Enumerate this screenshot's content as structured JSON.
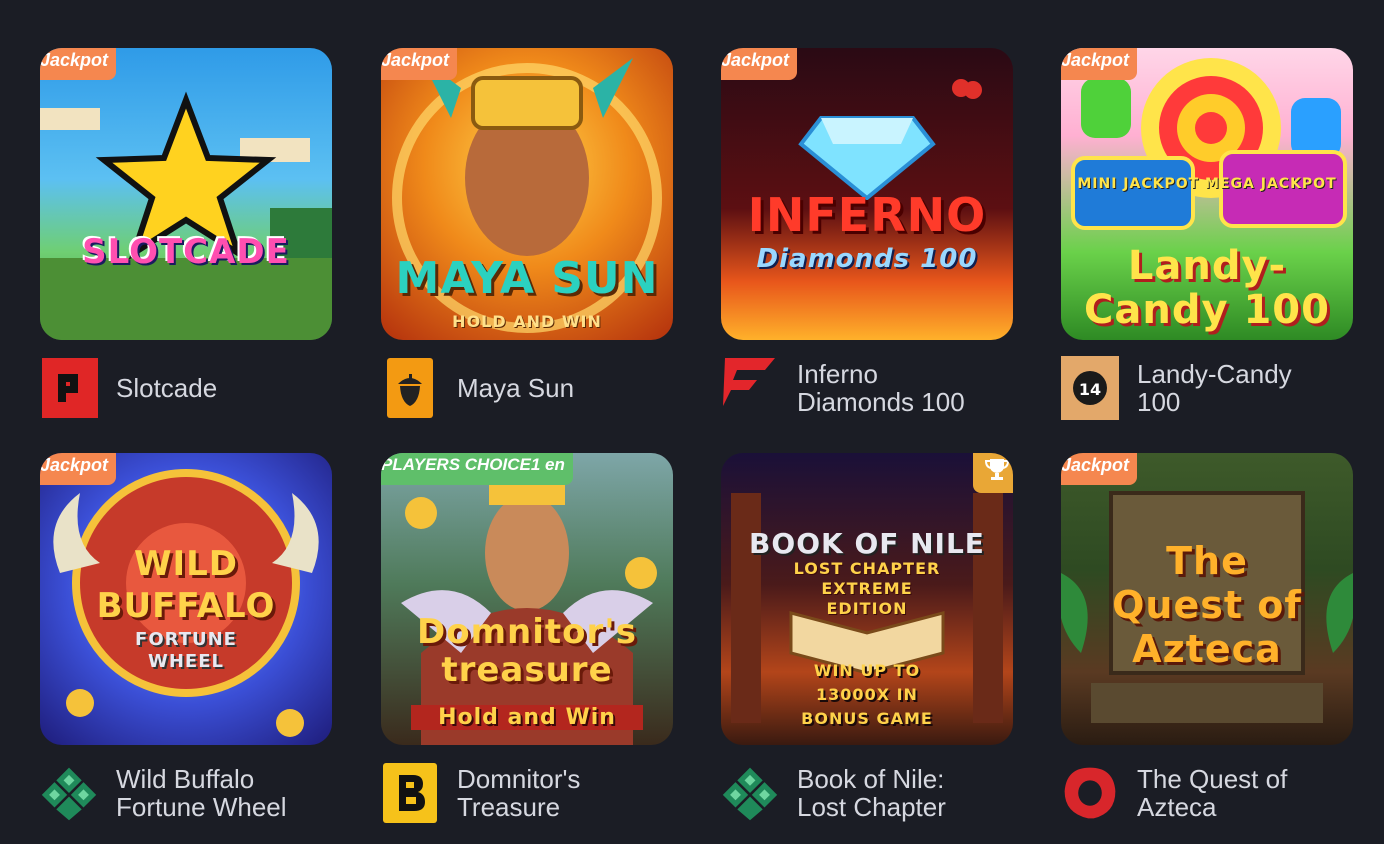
{
  "games": [
    {
      "name": "Slotcade",
      "badge": "Jackpot",
      "art_title": "SLOTCADE",
      "provider_icon": "provider-p-icon"
    },
    {
      "name": "Maya Sun",
      "badge": "Jackpot",
      "art_title": "MAYA SUN",
      "art_subtitle": "HOLD AND WIN",
      "provider_icon": "provider-acorn-icon"
    },
    {
      "name": "Inferno Diamonds 100",
      "badge": "Jackpot",
      "art_title": "INFERNO",
      "art_subtitle": "Diamonds 100",
      "provider_icon": "provider-f-icon"
    },
    {
      "name": "Landy-Candy 100",
      "badge": "Jackpot",
      "art_title": "Landy-Candy 100",
      "art_subtitle": "MINI JACKPOT  MEGA JACKPOT",
      "provider_icon": "provider-14-icon",
      "provider_label": "14"
    },
    {
      "name": "Wild Buffalo Fortune Wheel",
      "badge": "Jackpot",
      "art_title": "WILD BUFFALO",
      "art_subtitle": "FORTUNE WHEEL",
      "provider_icon": "provider-diamond-icon"
    },
    {
      "name": "Domnitor's Treasure",
      "badge": "PLAYERS CHOICE1 en",
      "art_title": "Domnitor's treasure",
      "art_subtitle": "Hold and Win",
      "provider_icon": "provider-b-icon"
    },
    {
      "name": "Book of Nile: Lost Chapter",
      "badge_icon": "trophy-icon",
      "art_title": "BOOK OF NILE",
      "art_subtitle": "LOST CHAPTER EXTREME EDITION",
      "art_extra": "WIN UP TO 13000X IN BONUS GAME",
      "provider_icon": "provider-diamond-icon"
    },
    {
      "name": "The Quest of Azteca",
      "badge": "Jackpot",
      "art_title": "The Quest of Azteca",
      "provider_icon": "provider-red-ring-icon"
    }
  ],
  "colors": {
    "background": "#1b1d25",
    "jackpot_badge": "#f5874f",
    "choice_badge": "#5fbf6a",
    "trophy_badge": "#e9a736",
    "text": "#d6d8e0"
  }
}
